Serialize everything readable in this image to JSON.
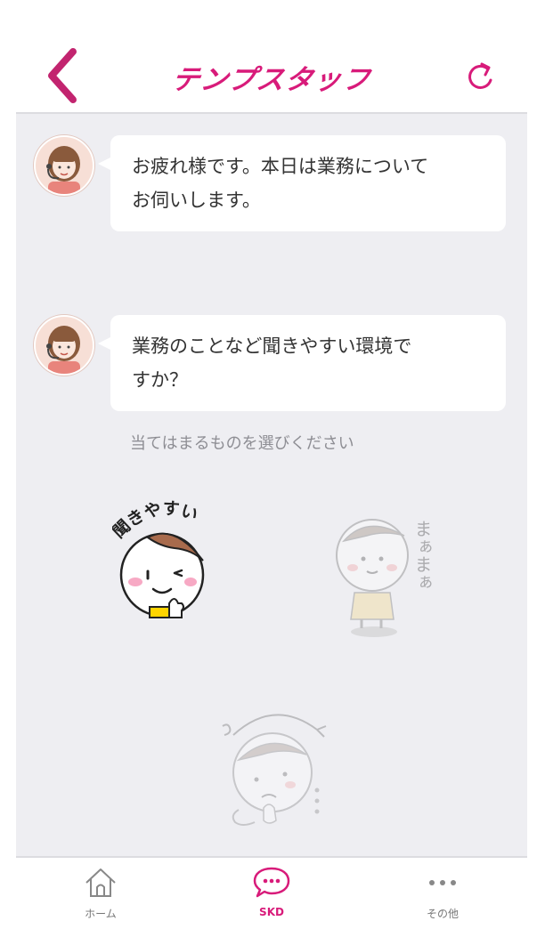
{
  "header": {
    "title": "テンプスタッフ",
    "back_icon": "chevron-left-icon",
    "refresh_icon": "refresh-icon"
  },
  "chat": {
    "messages": [
      {
        "text_line1": "お疲れ様です。本日は業務について",
        "text_line2": "お伺いします。"
      },
      {
        "text_line1": "業務のことなど聞きやすい環境で",
        "text_line2": "すか？"
      }
    ],
    "prompt": "当てはまるものを選びください",
    "choices": [
      {
        "label": "聞きやすい"
      },
      {
        "label": "まぁまぁ"
      }
    ]
  },
  "tabbar": {
    "tabs": [
      {
        "label": "ホーム",
        "icon": "home-icon"
      },
      {
        "label": "SKD",
        "icon": "chat-bubble-icon",
        "active": true
      },
      {
        "label": "その他",
        "icon": "more-icon"
      }
    ]
  },
  "colors": {
    "brand": "#d81b7a",
    "chat_bg": "#eeeef2"
  }
}
